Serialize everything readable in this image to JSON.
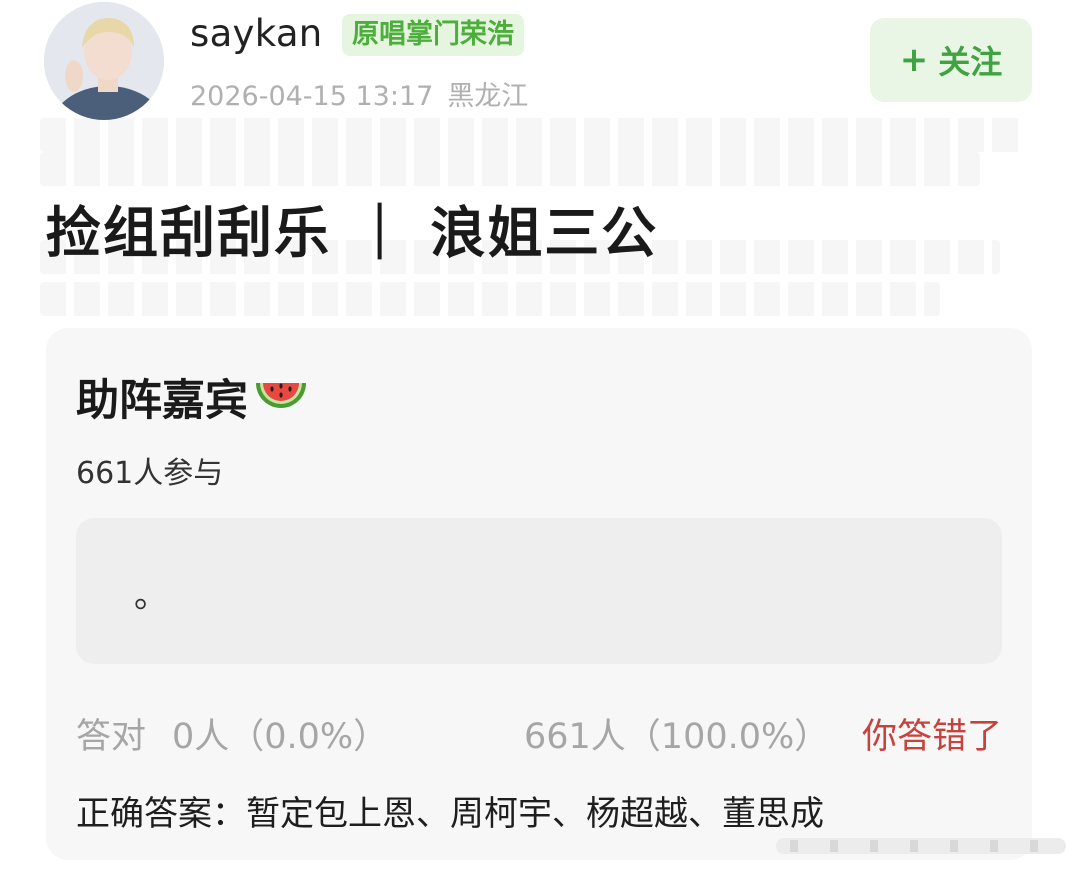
{
  "post": {
    "username": "saykan",
    "badge": "原唱掌门荣浩",
    "timestamp": "2026-04-15 13:17",
    "location": "黑龙江",
    "follow_label": "关注",
    "follow_plus": "+",
    "title": "捡组刮刮乐 ｜ 浪姐三公"
  },
  "quiz": {
    "heading": "助阵嘉宾",
    "emoji_icon": "watermelon-icon",
    "participants": "661人参与",
    "answer_text": "。",
    "correct_label": "答对",
    "correct_count": "0人（0.0%）",
    "wrong_count": "661人（100.0%）",
    "result_status": "你答错了",
    "correct_answer": "正确答案：暂定包上恩、周柯宇、杨超越、董思成"
  },
  "colors": {
    "accent_green": "#3fa341",
    "badge_bg": "#e6f5df",
    "error_red": "#c6423c"
  }
}
